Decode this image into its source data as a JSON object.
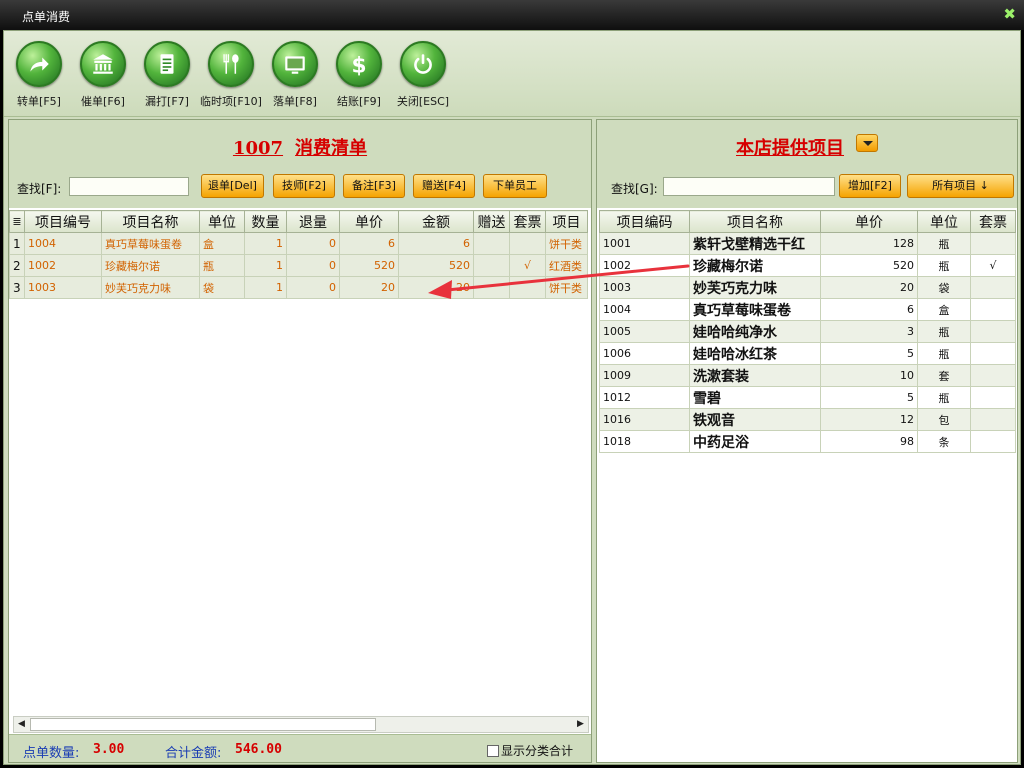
{
  "window": {
    "title": "点单消费",
    "close_glyph": "✖"
  },
  "toolbar": {
    "buttons": [
      {
        "label": "转单[F5]",
        "icon": "share-arrow-icon"
      },
      {
        "label": "催单[F6]",
        "icon": "bank-icon"
      },
      {
        "label": "漏打[F7]",
        "icon": "document-icon"
      },
      {
        "label": "临时项[F10]",
        "icon": "fork-spoon-icon"
      },
      {
        "label": "落单[F8]",
        "icon": "screen-icon"
      },
      {
        "label": "结账[F9]",
        "icon": "dollar-icon"
      },
      {
        "label": "关闭[ESC]",
        "icon": "power-icon"
      }
    ]
  },
  "left": {
    "title_no": "1007",
    "title_text": "消费清单",
    "search_label": "查找[F]:",
    "search_value": "",
    "buttons": [
      "退单[Del]",
      "技师[F2]",
      "备注[F3]",
      "赠送[F4]",
      "下单员工"
    ],
    "columns": [
      "≣",
      "项目编号",
      "项目名称",
      "单位",
      "数量",
      "退量",
      "单价",
      "金额",
      "赠送",
      "套票",
      "项目"
    ],
    "rows": [
      {
        "idx": "1",
        "code": "1004",
        "name": "真巧草莓味蛋卷",
        "unit": "盒",
        "qty": "1",
        "ret": "0",
        "price": "6",
        "amount": "6",
        "gift": "",
        "ticket": "",
        "cat": "饼干类"
      },
      {
        "idx": "2",
        "code": "1002",
        "name": "珍藏梅尔诺",
        "unit": "瓶",
        "qty": "1",
        "ret": "0",
        "price": "520",
        "amount": "520",
        "gift": "",
        "ticket": "√",
        "cat": "红酒类"
      },
      {
        "idx": "3",
        "code": "1003",
        "name": "妙芙巧克力味",
        "unit": "袋",
        "qty": "1",
        "ret": "0",
        "price": "20",
        "amount": "20",
        "gift": "",
        "ticket": "",
        "cat": "饼干类"
      }
    ],
    "footer": {
      "count_label": "点单数量:",
      "count_value": "3.00",
      "total_label": "合计金额:",
      "total_value": "546.00",
      "checkbox_label": "显示分类合计"
    }
  },
  "right": {
    "title": "本店提供项目",
    "search_label": "查找[G]:",
    "search_value": "",
    "add_button": "增加[F2]",
    "all_button": "所有项目 ↓",
    "columns": [
      "项目编码",
      "项目名称",
      "单价",
      "单位",
      "套票"
    ],
    "rows": [
      {
        "code": "1001",
        "name": "紫轩戈壁精选干红",
        "price": "128",
        "unit": "瓶",
        "ticket": ""
      },
      {
        "code": "1002",
        "name": "珍藏梅尔诺",
        "price": "520",
        "unit": "瓶",
        "ticket": "√"
      },
      {
        "code": "1003",
        "name": "妙芙巧克力味",
        "price": "20",
        "unit": "袋",
        "ticket": ""
      },
      {
        "code": "1004",
        "name": "真巧草莓味蛋卷",
        "price": "6",
        "unit": "盒",
        "ticket": ""
      },
      {
        "code": "1005",
        "name": "娃哈哈纯净水",
        "price": "3",
        "unit": "瓶",
        "ticket": ""
      },
      {
        "code": "1006",
        "name": "娃哈哈冰红茶",
        "price": "5",
        "unit": "瓶",
        "ticket": ""
      },
      {
        "code": "1009",
        "name": "洗漱套装",
        "price": "10",
        "unit": "套",
        "ticket": ""
      },
      {
        "code": "1012",
        "name": "雪碧",
        "price": "5",
        "unit": "瓶",
        "ticket": ""
      },
      {
        "code": "1016",
        "name": "铁观音",
        "price": "12",
        "unit": "包",
        "ticket": ""
      },
      {
        "code": "1018",
        "name": "中药足浴",
        "price": "98",
        "unit": "条",
        "ticket": ""
      }
    ]
  },
  "colors": {
    "accent_red": "#d60000",
    "annotation_arrow": "#e8323c",
    "orange_text": "#d26200",
    "footer_blue": "#1a3db3"
  }
}
